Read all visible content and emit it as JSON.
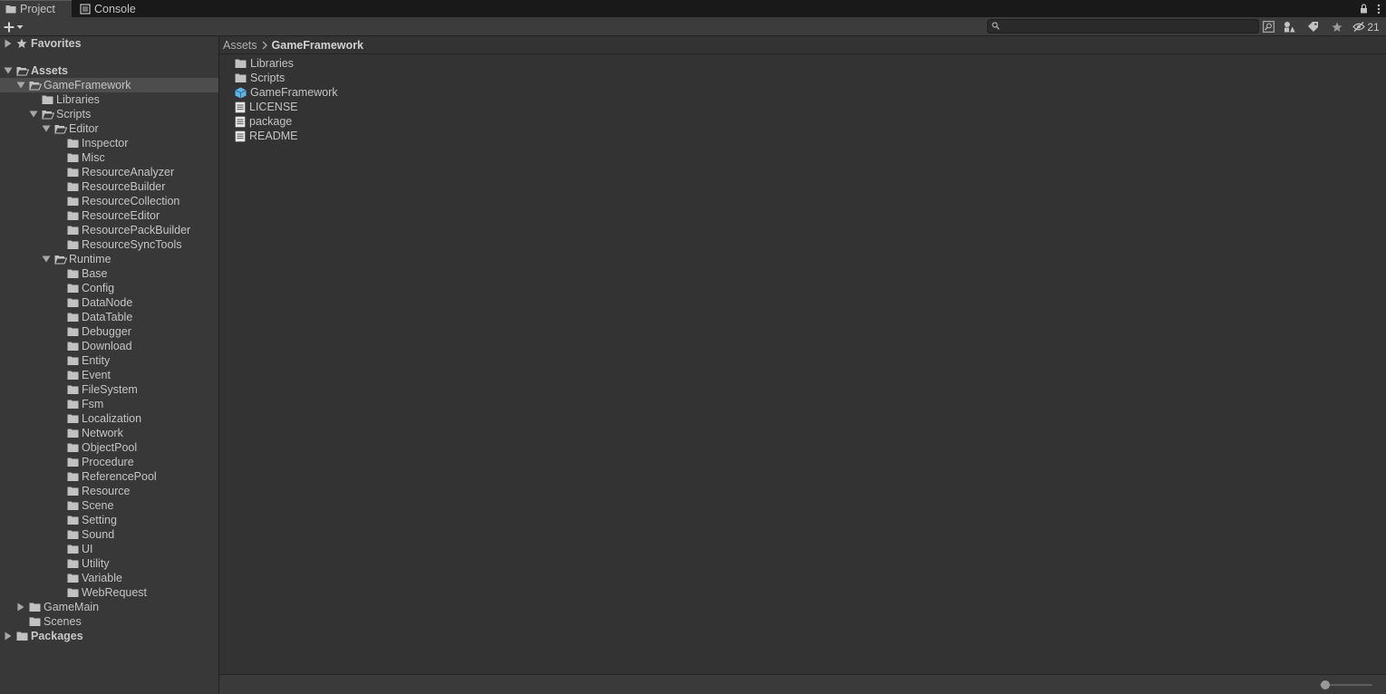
{
  "tabs": [
    {
      "label": "Project",
      "icon": "folder-icon",
      "active": true
    },
    {
      "label": "Console",
      "icon": "console-icon",
      "active": false
    }
  ],
  "toolbar": {
    "create_icon": "plus-icon",
    "search_placeholder": "",
    "search_value": "",
    "hidden_count": "21"
  },
  "tree": {
    "favorites": "Favorites",
    "assets": "Assets",
    "gameframework": "GameFramework",
    "libraries": "Libraries",
    "scripts": "Scripts",
    "editor": "Editor",
    "editor_children": [
      "Inspector",
      "Misc",
      "ResourceAnalyzer",
      "ResourceBuilder",
      "ResourceCollection",
      "ResourceEditor",
      "ResourcePackBuilder",
      "ResourceSyncTools"
    ],
    "runtime": "Runtime",
    "runtime_children": [
      "Base",
      "Config",
      "DataNode",
      "DataTable",
      "Debugger",
      "Download",
      "Entity",
      "Event",
      "FileSystem",
      "Fsm",
      "Localization",
      "Network",
      "ObjectPool",
      "Procedure",
      "ReferencePool",
      "Resource",
      "Scene",
      "Setting",
      "Sound",
      "UI",
      "Utility",
      "Variable",
      "WebRequest"
    ],
    "gamemain": "GameMain",
    "scenes": "Scenes",
    "packages": "Packages"
  },
  "breadcrumb": {
    "root": "Assets",
    "current": "GameFramework"
  },
  "content_items": [
    {
      "label": "Libraries",
      "kind": "folder"
    },
    {
      "label": "Scripts",
      "kind": "folder"
    },
    {
      "label": "GameFramework",
      "kind": "assembly"
    },
    {
      "label": "LICENSE",
      "kind": "file"
    },
    {
      "label": "package",
      "kind": "file"
    },
    {
      "label": "README",
      "kind": "file"
    }
  ],
  "colors": {
    "folder": "#c2c2c2",
    "assembly": "#5fb3e8",
    "selected_row": "#4d4d4d"
  },
  "zoom_level": 0.0
}
